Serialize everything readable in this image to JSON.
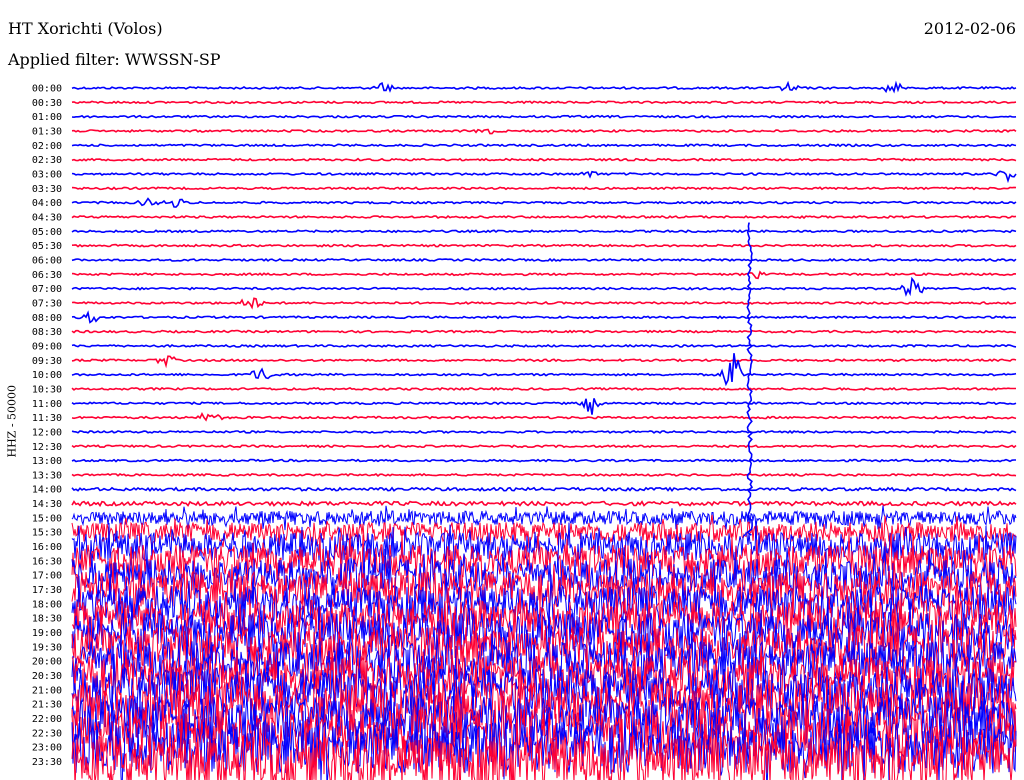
{
  "header": {
    "station": "HT Xorichti (Volos)",
    "date": "2012-02-06",
    "filter": "Applied filter: WWSSN-SP",
    "scale": "HHZ - 50000"
  },
  "colors": {
    "even": "#0000ff",
    "odd": "#ff0033",
    "background": "#ffffff"
  },
  "chart_data": {
    "type": "line",
    "title": "HT Xorichti (Volos)",
    "ylabel": "HHZ - 50000",
    "row_labels": [
      "00:00",
      "00:30",
      "01:00",
      "01:30",
      "02:00",
      "02:30",
      "03:00",
      "03:30",
      "04:00",
      "04:30",
      "05:00",
      "05:30",
      "06:00",
      "06:30",
      "07:00",
      "07:30",
      "08:00",
      "08:30",
      "09:00",
      "09:30",
      "10:00",
      "10:30",
      "11:00",
      "11:30",
      "12:00",
      "12:30",
      "13:00",
      "13:30",
      "14:00",
      "14:30",
      "15:00",
      "15:30",
      "16:00",
      "16:30",
      "17:00",
      "17:30",
      "18:00",
      "18:30",
      "19:00",
      "19:30",
      "20:00",
      "20:30",
      "21:00",
      "21:30",
      "22:00",
      "22:30",
      "23:00",
      "23:30"
    ],
    "row_noise": [
      1,
      1,
      1,
      1,
      1,
      1,
      1,
      1,
      1,
      1,
      1,
      1,
      1,
      1,
      1,
      1,
      1,
      1,
      1,
      1,
      1,
      1,
      1,
      1,
      1,
      1,
      1,
      1,
      1.5,
      2,
      7,
      10,
      14,
      16,
      16,
      18,
      18,
      18,
      20,
      20,
      20,
      20,
      22,
      22,
      22,
      24,
      26,
      26
    ],
    "events": [
      {
        "row": 0,
        "x": 0.33,
        "amp": 6
      },
      {
        "row": 0,
        "x": 0.76,
        "amp": 6
      },
      {
        "row": 0,
        "x": 0.87,
        "amp": 6
      },
      {
        "row": 3,
        "x": 0.44,
        "amp": 4
      },
      {
        "row": 6,
        "x": 0.55,
        "amp": 4
      },
      {
        "row": 6,
        "x": 0.99,
        "amp": 7
      },
      {
        "row": 8,
        "x": 0.08,
        "amp": 5
      },
      {
        "row": 8,
        "x": 0.11,
        "amp": 5
      },
      {
        "row": 13,
        "x": 0.73,
        "amp": 6
      },
      {
        "row": 14,
        "x": 0.89,
        "amp": 12
      },
      {
        "row": 15,
        "x": 0.19,
        "amp": 8
      },
      {
        "row": 16,
        "x": 0.02,
        "amp": 6
      },
      {
        "row": 19,
        "x": 0.1,
        "amp": 6
      },
      {
        "row": 20,
        "x": 0.2,
        "amp": 9
      },
      {
        "row": 20,
        "x": 0.7,
        "amp": 24
      },
      {
        "row": 22,
        "x": 0.55,
        "amp": 13
      },
      {
        "row": 23,
        "x": 0.15,
        "amp": 5
      },
      {
        "row": 23,
        "x": 0.14,
        "amp": 4
      }
    ],
    "spike": {
      "row_start": 10,
      "row_end": 31,
      "x": 0.718
    }
  }
}
